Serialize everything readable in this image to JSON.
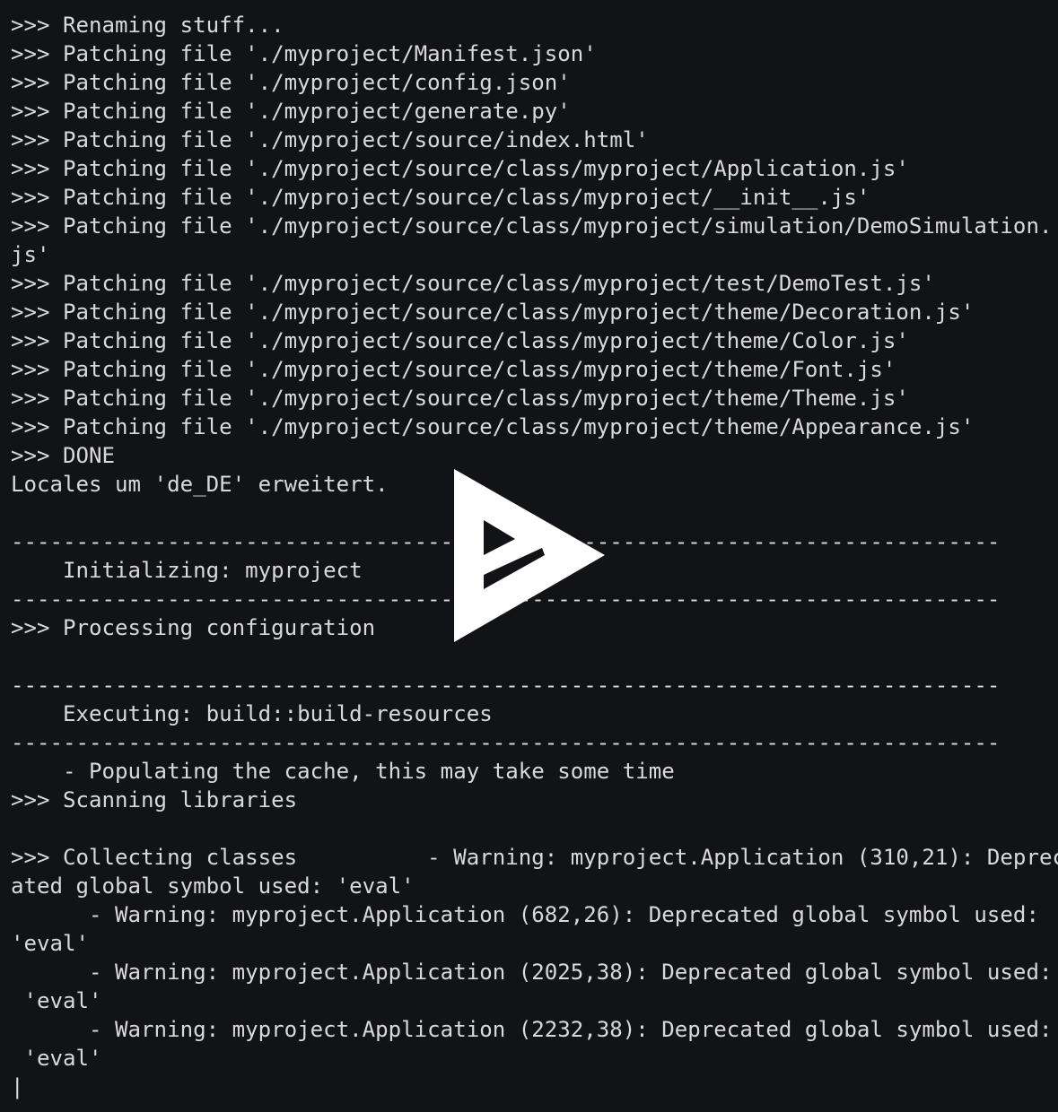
{
  "terminal": {
    "lines": [
      ">>> Renaming stuff...",
      ">>> Patching file './myproject/Manifest.json'",
      ">>> Patching file './myproject/config.json'",
      ">>> Patching file './myproject/generate.py'",
      ">>> Patching file './myproject/source/index.html'",
      ">>> Patching file './myproject/source/class/myproject/Application.js'",
      ">>> Patching file './myproject/source/class/myproject/__init__.js'",
      ">>> Patching file './myproject/source/class/myproject/simulation/DemoSimulation.",
      "js'",
      ">>> Patching file './myproject/source/class/myproject/test/DemoTest.js'",
      ">>> Patching file './myproject/source/class/myproject/theme/Decoration.js'",
      ">>> Patching file './myproject/source/class/myproject/theme/Color.js'",
      ">>> Patching file './myproject/source/class/myproject/theme/Font.js'",
      ">>> Patching file './myproject/source/class/myproject/theme/Theme.js'",
      ">>> Patching file './myproject/source/class/myproject/theme/Appearance.js'",
      ">>> DONE",
      "Locales um 'de_DE' erweitert.",
      "",
      "----------------------------------------------------------------------------",
      "    Initializing: myproject",
      "----------------------------------------------------------------------------",
      ">>> Processing configuration",
      "",
      "----------------------------------------------------------------------------",
      "    Executing: build::build-resources",
      "----------------------------------------------------------------------------",
      "    - Populating the cache, this may take some time",
      ">>> Scanning libraries",
      "",
      ">>> Collecting classes          - Warning: myproject.Application (310,21): Deprec",
      "ated global symbol used: 'eval'",
      "      - Warning: myproject.Application (682,26): Deprecated global symbol used:",
      "'eval'",
      "      - Warning: myproject.Application (2025,38): Deprecated global symbol used:",
      " 'eval'",
      "      - Warning: myproject.Application (2232,38): Deprecated global symbol used:",
      " 'eval'",
      "|"
    ]
  },
  "overlay": {
    "icon": "play-icon",
    "color": "#ffffff"
  }
}
